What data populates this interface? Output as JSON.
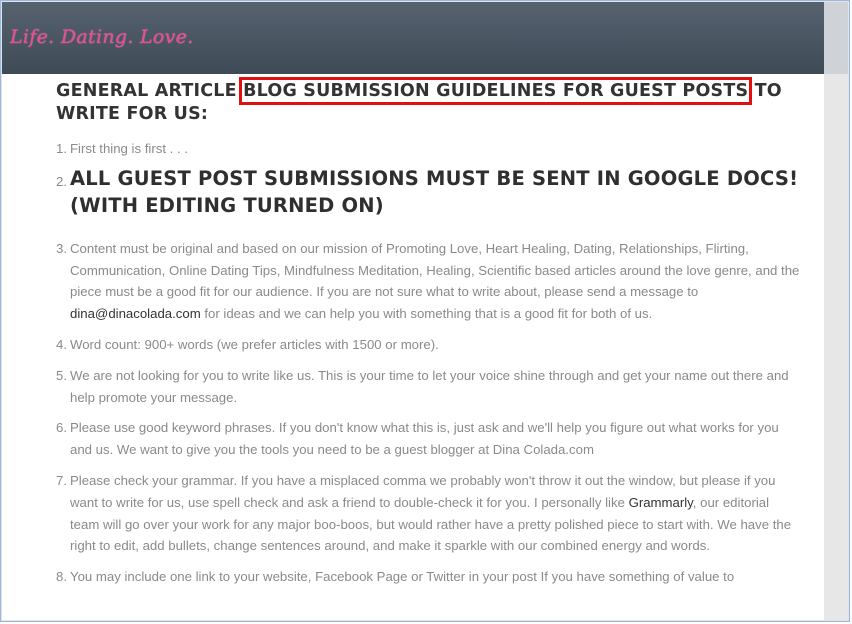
{
  "header": {
    "logo_text": "Life. Dating. Love."
  },
  "title": {
    "part1": "GENERAL ARTICLE ",
    "highlight": "BLOG SUBMISSION GUIDELINES FOR GUEST POSTS",
    "part2": " TO WRITE FOR US:"
  },
  "items": [
    {
      "num": "1.",
      "text": "First thing is first . . ."
    },
    {
      "num": "2.",
      "text": "ALL GUEST POST SUBMISSIONS MUST BE SENT IN GOOGLE DOCS! (WITH EDITING TURNED ON)"
    },
    {
      "num": "3.",
      "text": "Content must be original and based on our mission of Promoting Love, Heart Healing, Dating, Relationships, Flirting, Communication, Online Dating Tips, Mindfulness Meditation, Healing, Scientific based articles around the love genre, and the piece must be a good fit for our audience. If you are not sure what to write about, please send a message to",
      "email": "dina@dinacolada.com",
      "text_after": " for ideas and we can help you with something that is a good fit for both of us."
    },
    {
      "num": "4.",
      "text": "Word count: 900+ words (we prefer articles with 1500 or more)."
    },
    {
      "num": "5.",
      "text": "We are not looking for you to write like us. This is your time to let your voice shine through and get your name out there and help promote your message."
    },
    {
      "num": "6.",
      "text": "Please use good keyword phrases. If you don't know what this is, just ask and we'll help you figure out what works for you and us. We want to give you the tools you need to be a guest blogger at Dina Colada.com"
    },
    {
      "num": "7.",
      "text_before": "Please check your grammar. If you have a misplaced comma we probably won't throw it out the window, but please if you want to write for us, use spell check and ask a friend to double-check it for you. I personally like ",
      "link": "Grammarly",
      "text_after": ", our editorial team will go over your work for any major boo-boos, but would rather have a pretty polished piece to start with. We have the right to edit, add bullets, change sentences around, and make it sparkle with our combined energy and words."
    },
    {
      "num": "8.",
      "text": "You may include one link to your website, Facebook Page or Twitter in your post If you have something of value to"
    }
  ]
}
